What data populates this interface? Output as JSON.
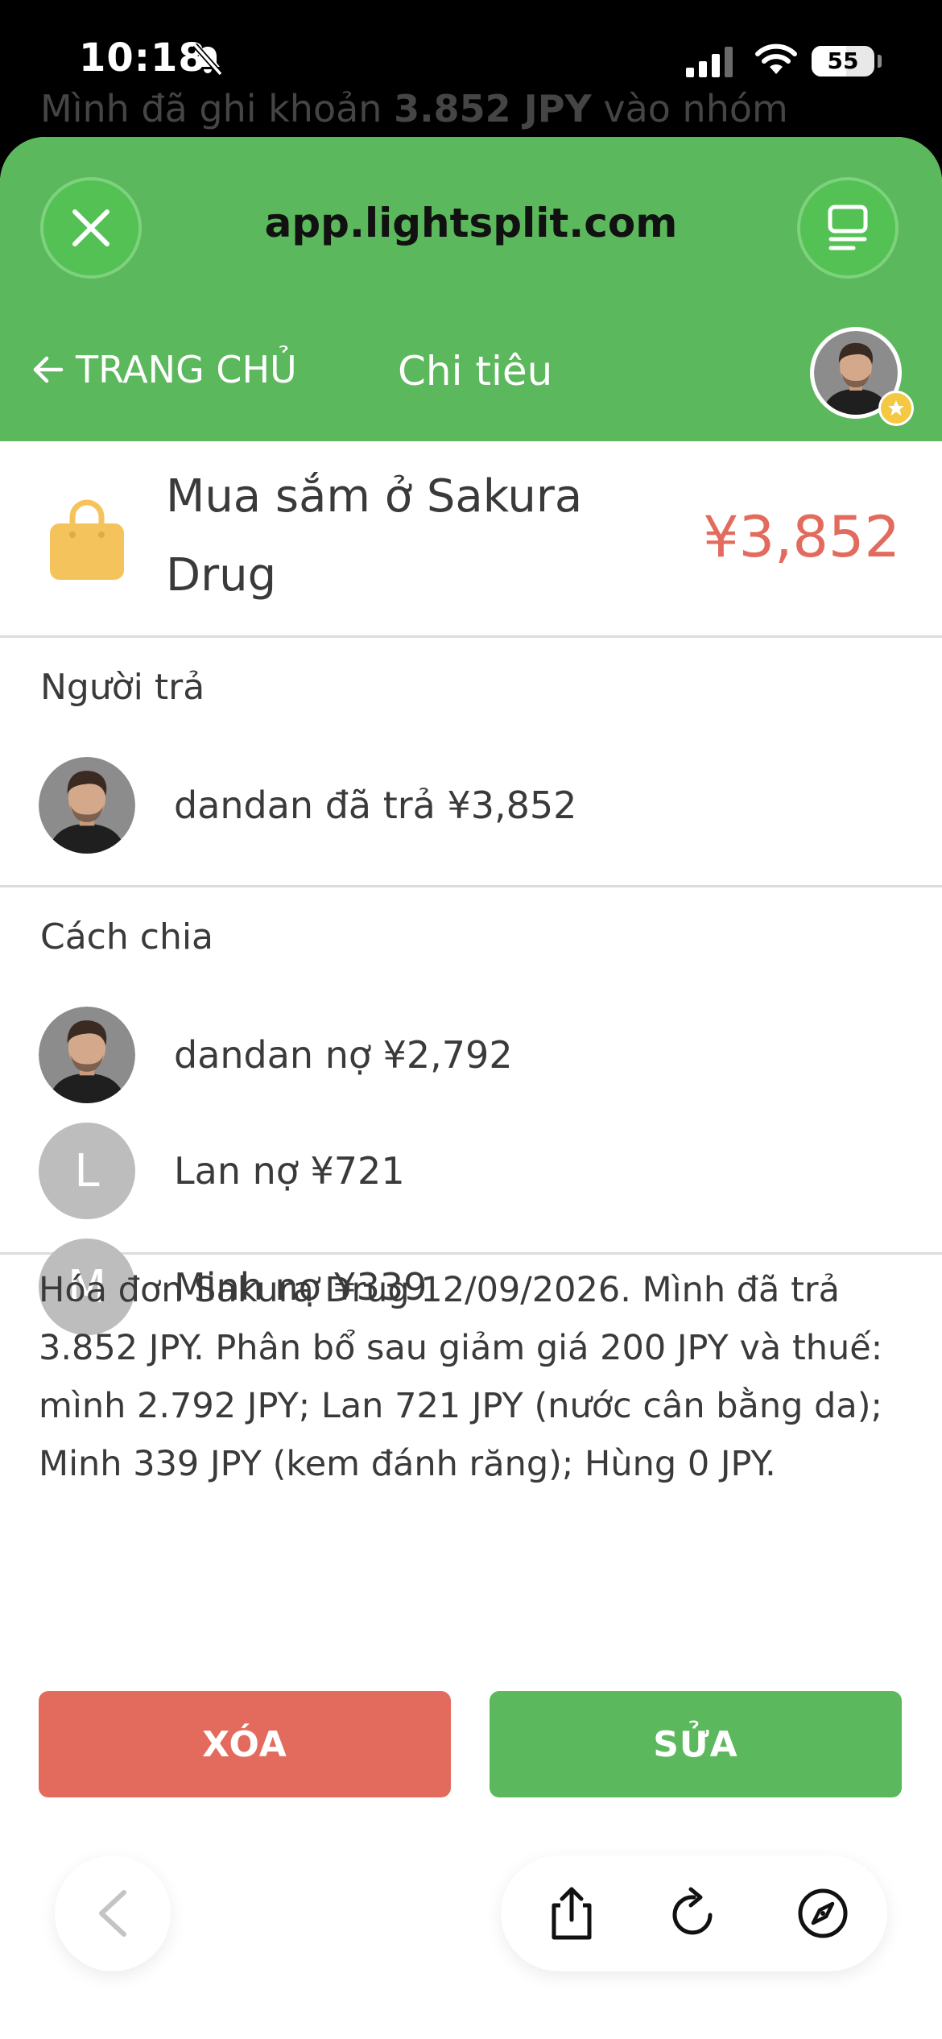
{
  "status_bar": {
    "time": "10:18",
    "battery": "55",
    "battery_level": 0.55
  },
  "behind": {
    "prefix": "Mình đã ghi khoản ",
    "bold": "3.852 JPY",
    "suffix": " vào nhóm"
  },
  "browser": {
    "url": "app.lightsplit.com"
  },
  "nav": {
    "back_label": "TRANG CHỦ",
    "title": "Chi tiêu"
  },
  "expense": {
    "title": "Mua sắm ở Sakura Drug",
    "amount": "¥3,852"
  },
  "payer": {
    "section_title": "Người trả",
    "text": "dandan đã trả ¥3,852"
  },
  "split": {
    "section_title": "Cách chia",
    "rows": [
      {
        "initial": "",
        "text": "dandan nợ ¥2,792"
      },
      {
        "initial": "L",
        "text": "Lan nợ ¥721"
      },
      {
        "initial": "M",
        "text": "Minh nợ ¥339"
      }
    ]
  },
  "note": "Hóa đơn Sakura Drug 12/09/2026. Mình đã trả 3.852 JPY. Phân bổ sau giảm giá 200 JPY và thuế: mình 2.792 JPY; Lan 721 JPY (nước cân bằng da); Minh 339 JPY (kem đánh răng); Hùng 0 JPY.",
  "actions": {
    "delete_label": "XÓA",
    "edit_label": "SỬA"
  },
  "colors": {
    "brand_green": "#5cb85c",
    "danger_red": "#e36b5e",
    "bag_yellow": "#f5c35c"
  },
  "icons": {
    "close": "close-icon",
    "tabs": "tabs-icon",
    "back_arrow": "arrow-left-icon",
    "bag": "shopping-bag-icon",
    "share": "share-icon",
    "reload": "reload-icon",
    "compass": "compass-icon"
  }
}
